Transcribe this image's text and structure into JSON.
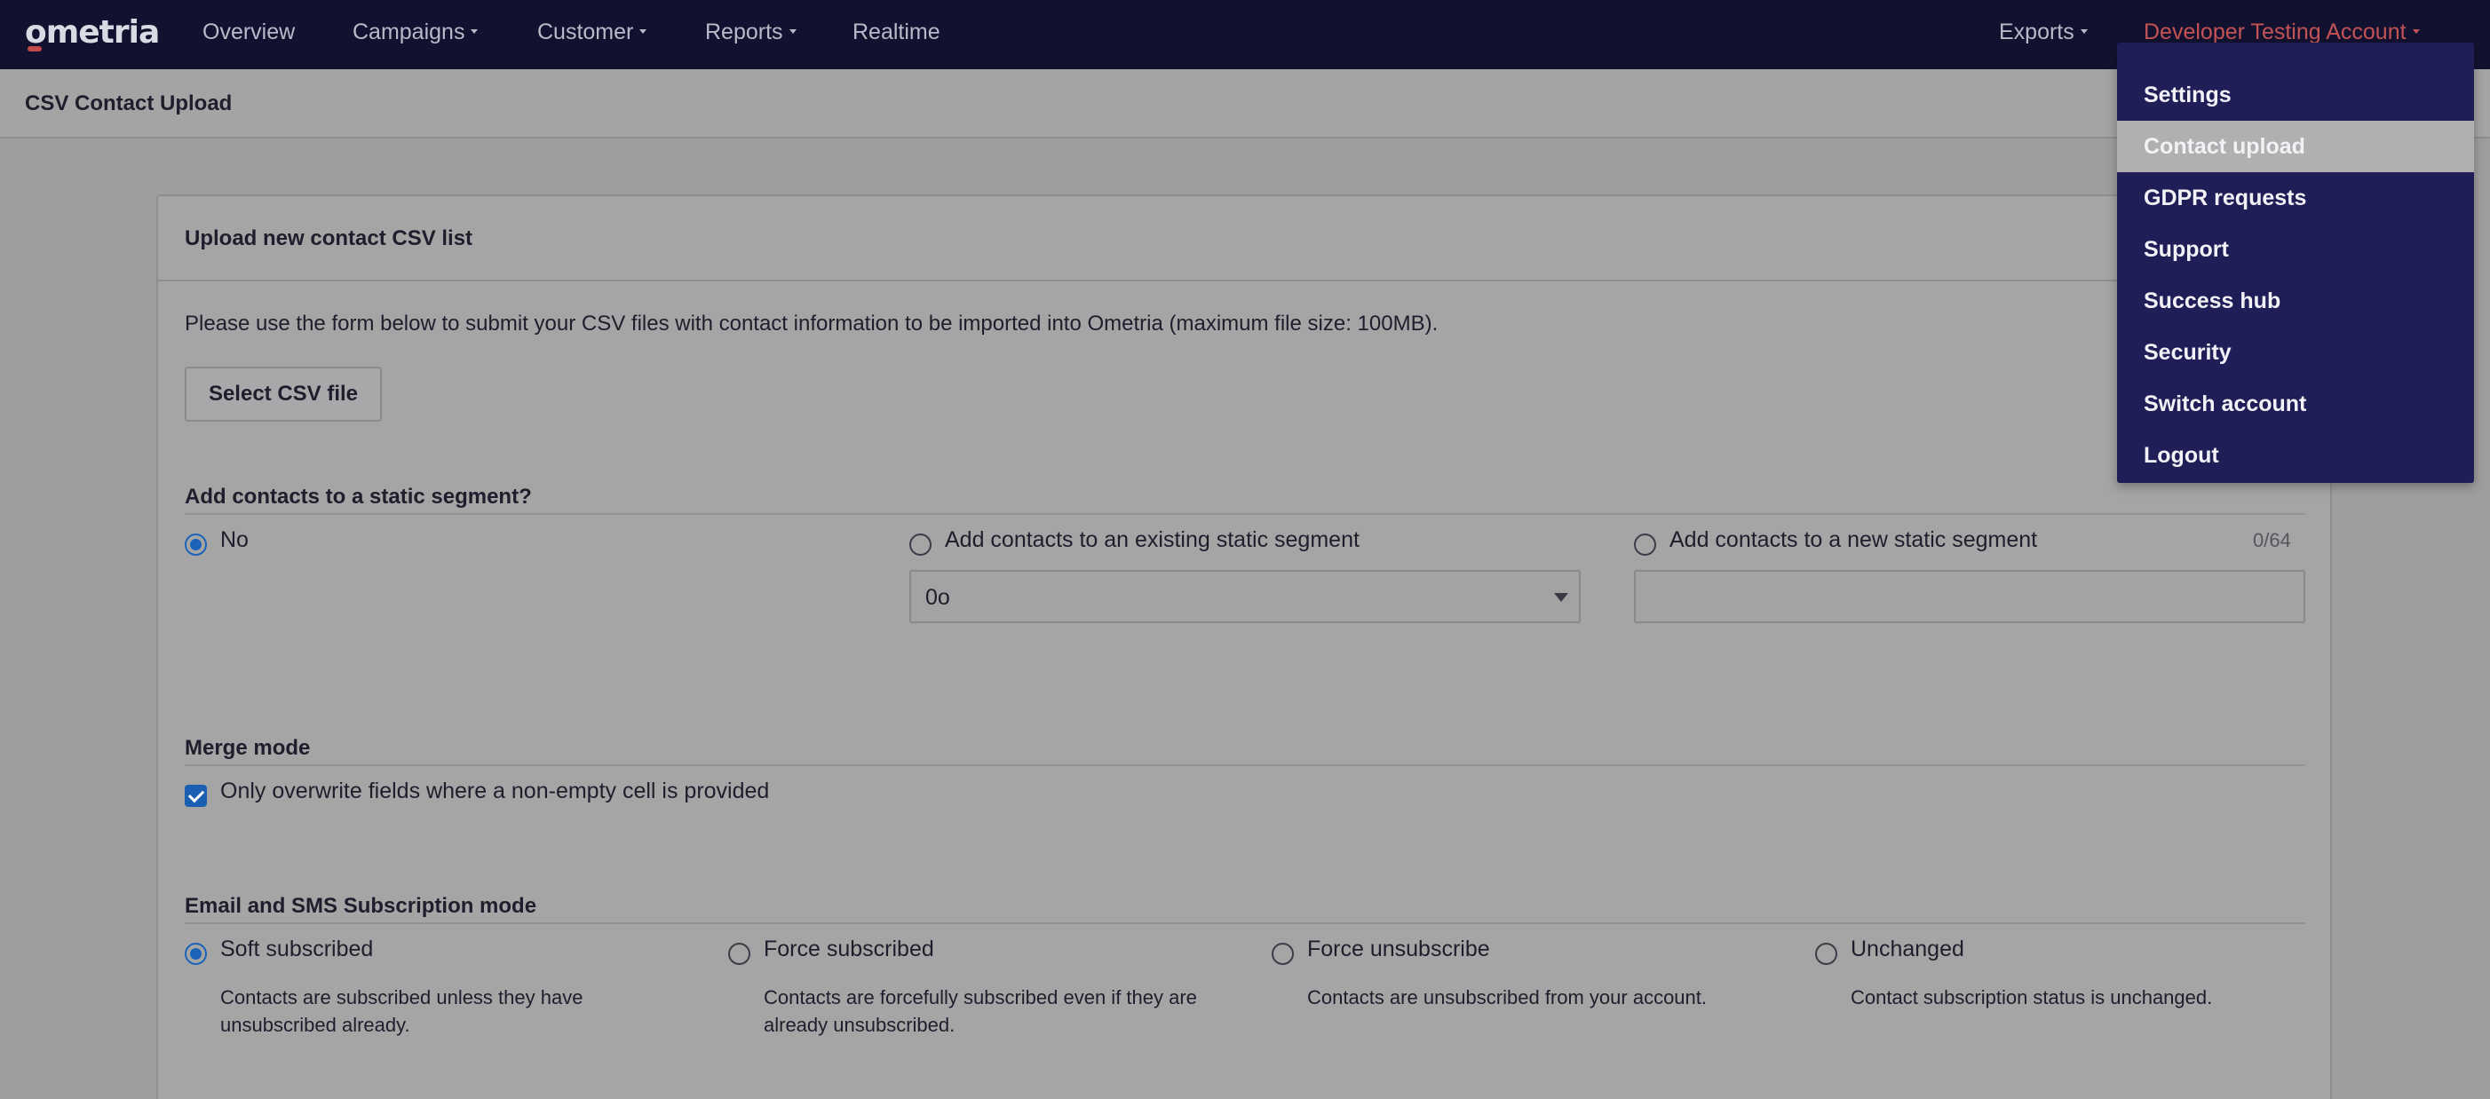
{
  "nav": {
    "logo": "ometria",
    "overview": "Overview",
    "campaigns": "Campaigns",
    "customer": "Customer",
    "reports": "Reports",
    "realtime": "Realtime",
    "exports": "Exports",
    "account": "Developer Testing Account"
  },
  "page_title": "CSV Contact Upload",
  "card": {
    "title": "Upload new contact CSV list",
    "intro": "Please use the form below to submit your CSV files with contact information to be imported into Ometria (maximum file size: 100MB).",
    "select_button": "Select CSV file"
  },
  "segment": {
    "title": "Add contacts to a static segment?",
    "no_label": "No",
    "existing_label": "Add contacts to an existing static segment",
    "existing_selected": "0o",
    "new_label": "Add contacts to a new static segment",
    "new_value": "",
    "counter": "0/64"
  },
  "merge": {
    "title": "Merge mode",
    "overwrite_label": "Only overwrite fields where a non-empty cell is provided"
  },
  "subscription": {
    "title": "Email and SMS Subscription mode",
    "options": [
      {
        "label": "Soft subscribed",
        "desc": "Contacts are subscribed unless they have unsubscribed already."
      },
      {
        "label": "Force subscribed",
        "desc": "Contacts are forcefully subscribed even if they are already unsubscribed."
      },
      {
        "label": "Force unsubscribe",
        "desc": "Contacts are unsubscribed from your account."
      },
      {
        "label": "Unchanged",
        "desc": "Contact subscription status is unchanged."
      }
    ]
  },
  "menu": {
    "items": [
      "Settings",
      "Contact upload",
      "GDPR requests",
      "Support",
      "Success hub",
      "Security",
      "Switch account",
      "Logout"
    ],
    "active": "Contact upload"
  },
  "colors": {
    "nav_bg": "#121230",
    "menu_bg": "#1f1e57",
    "accent_red": "#c45356",
    "radio_blue": "#1b63b9"
  }
}
